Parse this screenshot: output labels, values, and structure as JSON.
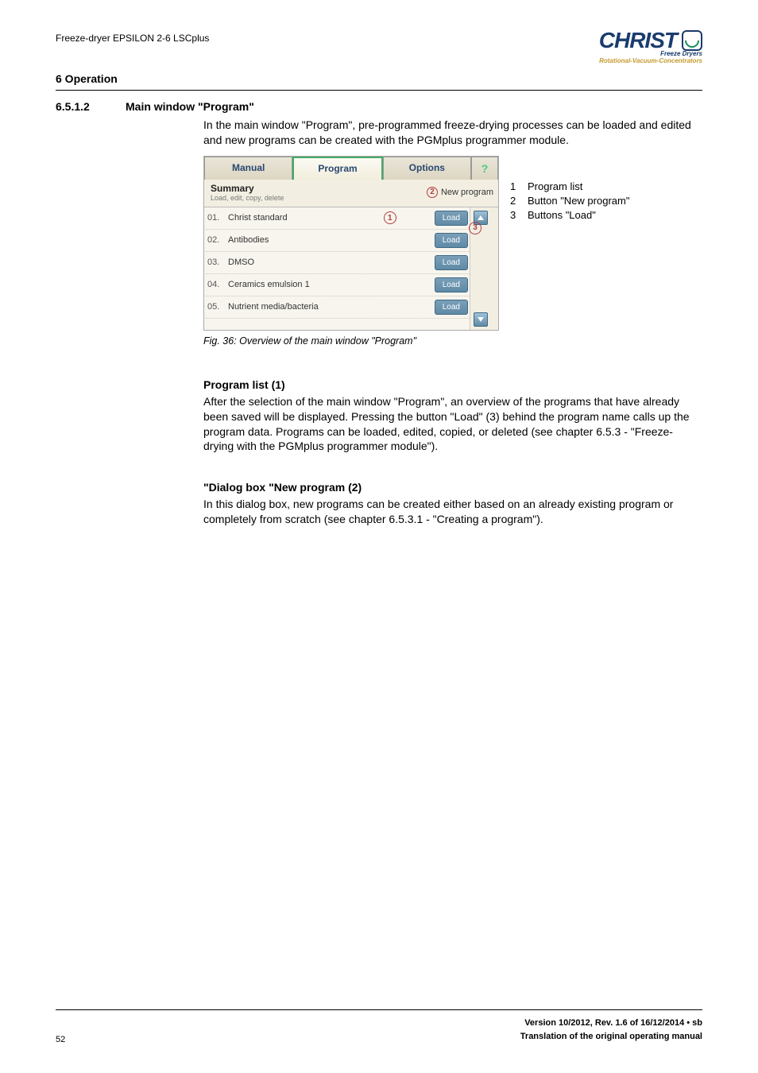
{
  "header": {
    "doc_title": "Freeze-dryer EPSILON 2-6 LSCplus",
    "logo_main": "CHRIST",
    "logo_line1": "Freeze Dryers",
    "logo_line2": "Rotational-Vacuum-Concentrators"
  },
  "section": {
    "title": "6 Operation",
    "sub_num": "6.5.1.2",
    "sub_title": "Main window \"Program\"",
    "intro": "In the main window \"Program\", pre-programmed freeze-drying processes can be loaded and edited and new programs can be created with the PGMplus programmer module."
  },
  "screenshot": {
    "tabs": {
      "manual": "Manual",
      "program": "Program",
      "options": "Options",
      "help": "?"
    },
    "summary_label": "Summary",
    "summary_sub": "Load, edit, copy, delete",
    "new_program": "New program",
    "load_label": "Load",
    "programs": [
      {
        "num": "01.",
        "name": "Christ standard"
      },
      {
        "num": "02.",
        "name": "Antibodies"
      },
      {
        "num": "03.",
        "name": "DMSO"
      },
      {
        "num": "04.",
        "name": "Ceramics emulsion 1"
      },
      {
        "num": "05.",
        "name": "Nutrient media/bacteria"
      }
    ],
    "markers": {
      "m1": "1",
      "m2": "2",
      "m3": "3"
    }
  },
  "legend": [
    {
      "n": "1",
      "t": "Program list"
    },
    {
      "n": "2",
      "t": "Button \"New program\""
    },
    {
      "n": "3",
      "t": "Buttons \"Load\""
    }
  ],
  "fig_caption": "Fig. 36: Overview of the main window \"Program\"",
  "prog_list": {
    "head": "Program list (1)",
    "body": "After the selection of the main window \"Program\", an overview of the programs that have already been saved will be displayed. Pressing the button \"Load\" (3) behind the program name calls up the program data. Programs can be loaded, edited, copied, or deleted (see chapter 6.5.3 - \"Freeze-drying with the PGMplus programmer module\")."
  },
  "dialog": {
    "head": "\"Dialog box \"New program (2)",
    "body": "In this dialog box, new programs can be created either based on an already existing program or completely from scratch (see chapter 6.5.3.1 - \"Creating a program\")."
  },
  "footer": {
    "page": "52",
    "version": "Version 10/2012, Rev. 1.6 of 16/12/2014 • sb",
    "trans": "Translation of the original operating manual"
  }
}
